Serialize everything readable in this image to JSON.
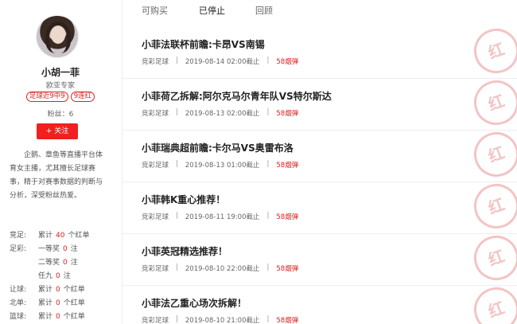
{
  "tabs": [
    "可购买",
    "已停止",
    "回顾"
  ],
  "active_tab": "已停止",
  "profile": {
    "name": "小胡一菲",
    "title": "欧亚专家",
    "tags": [
      "足球近9中9",
      "9连红"
    ],
    "fans_label": "粉丝：6",
    "follow_label": "+  关注",
    "bio": "企鹅、章鱼等直播平台体育女主播，尤其擅长足球赛事，精于对赛事数据的判断与分析，深受粉丝热爱。"
  },
  "stats": [
    {
      "k": "竞足:",
      "pre": "累计",
      "num": "40",
      "post": "个红单"
    },
    {
      "k": "足彩:",
      "pre": "一等奖",
      "num": "0",
      "post": "注"
    },
    {
      "k": "",
      "pre": "二等奖",
      "num": "0",
      "post": "注"
    },
    {
      "k": "",
      "pre": "任九",
      "num": "0",
      "post": "注"
    },
    {
      "k": "让球:",
      "pre": "累计",
      "num": "0",
      "post": "个红单"
    },
    {
      "k": "北单:",
      "pre": "累计",
      "num": "0",
      "post": "个红单"
    },
    {
      "k": "篮球:",
      "pre": "累计",
      "num": "0",
      "post": "个红单"
    }
  ],
  "articles": [
    {
      "title": "小菲法联杯前瞻:卡昂VS南锡",
      "category": "竞彩足球",
      "deadline": "2019-08-14 02:00截止",
      "price": "58烟弹",
      "stamp": "红"
    },
    {
      "title": "小菲荷乙拆解:阿尔克马尔青年队VS特尔斯达",
      "category": "竞彩足球",
      "deadline": "2019-08-13 02:00截止",
      "price": "58烟弹",
      "stamp": "红"
    },
    {
      "title": "小菲瑞典超前瞻:卡尔马VS奥雷布洛",
      "category": "竞彩足球",
      "deadline": "2019-08-13 01:00截止",
      "price": "58烟弹",
      "stamp": "红"
    },
    {
      "title": "小菲韩K重心推荐！",
      "category": "竞彩足球",
      "deadline": "2019-08-11 19:00截止",
      "price": "58烟弹",
      "stamp": "红"
    },
    {
      "title": "小菲英冠精选推荐！",
      "category": "竞彩足球",
      "deadline": "2019-08-10 22:00截止",
      "price": "58烟弹",
      "stamp": "红"
    },
    {
      "title": "小菲法乙重心场次拆解！",
      "category": "竞彩足球",
      "deadline": "2019-08-10 21:00截止",
      "price": "58烟弹",
      "stamp": "红"
    }
  ]
}
